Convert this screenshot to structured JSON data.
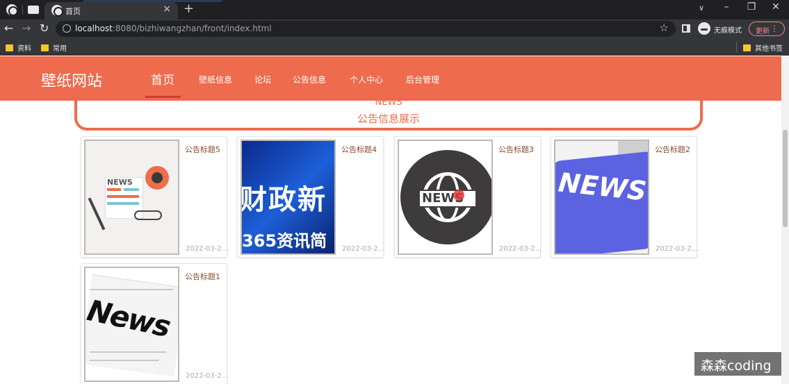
{
  "browser": {
    "active_tab_title": "首页",
    "url_host": "localhost",
    "url_rest": ":8080/bizhiwangzhan/front/index.html",
    "incognito_label": "无痕模式",
    "update_label": "更新",
    "bookmarks": [
      "资料",
      "常用"
    ],
    "other_bookmarks": "其他书签"
  },
  "site": {
    "logo": "壁纸网站",
    "nav": [
      "首页",
      "壁纸信息",
      "论坛",
      "公告信息",
      "个人中心",
      "后台管理"
    ],
    "active_nav": "首页"
  },
  "section": {
    "title_en": "NEWS",
    "title_cn": "公告信息展示"
  },
  "news": [
    {
      "title": "公告标题5",
      "date": "2022-03-2...",
      "image": "newspaper-illustration"
    },
    {
      "title": "公告标题4",
      "date": "2022-03-2...",
      "image": "blue-finance-news"
    },
    {
      "title": "公告标题3",
      "date": "2022-03-2...",
      "image": "globe-news-icon"
    },
    {
      "title": "公告标题2",
      "date": "2022-03-2...",
      "image": "news-keyboard-key"
    },
    {
      "title": "公告标题1",
      "date": "2022-03-2...",
      "image": "news-newspaper"
    }
  ],
  "thumb_text": {
    "t5": "NEWS",
    "t4_big": "财政新",
    "t4_small": "365资讯简",
    "t3": "NEWS",
    "t2": "NEWS",
    "t1": "News"
  },
  "watermark": "森森coding",
  "colors": {
    "header": "#ee6b4d",
    "accent": "#ee6b4d",
    "title_text": "#8a4a2b"
  }
}
